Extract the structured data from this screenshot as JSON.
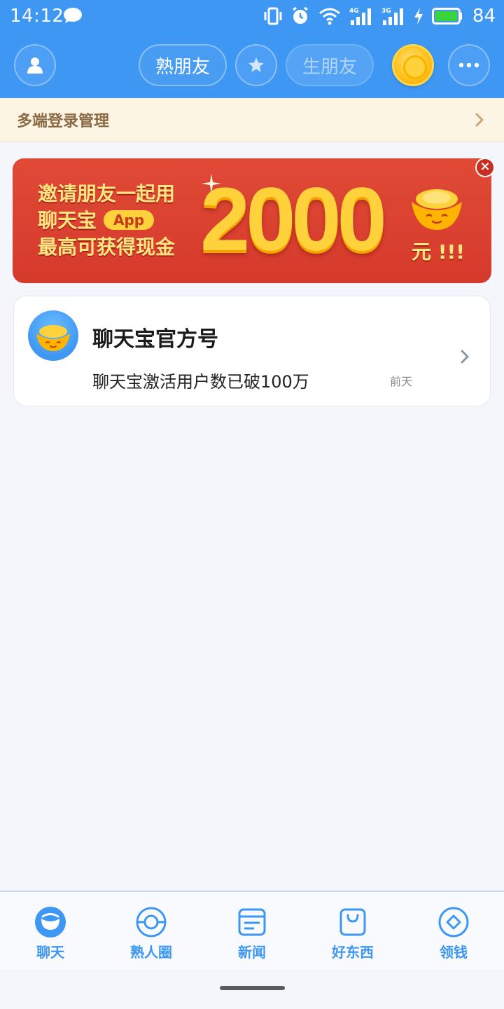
{
  "status_bar": {
    "time": "14:12",
    "battery_percent": "84",
    "signal_4g": "4G",
    "signal_3g": "3G"
  },
  "header": {
    "tab_familiar": "熟朋友",
    "tab_stranger": "生朋友",
    "accent_color": "#3d97f3"
  },
  "login_banner": {
    "label": "多端登录管理"
  },
  "promo": {
    "line1": "邀请朋友一起用",
    "line2": "聊天宝",
    "app_tag": "App",
    "line3": "最高可获得现金",
    "amount": "2000",
    "unit": "元 !!!"
  },
  "chat_list": [
    {
      "name": "聊天宝官方号",
      "preview": "聊天宝激活用户数已破100万",
      "time": "前天"
    }
  ],
  "tabbar": {
    "items": [
      {
        "label": "聊天",
        "icon": "chat-icon"
      },
      {
        "label": "熟人圈",
        "icon": "circle-icon"
      },
      {
        "label": "新闻",
        "icon": "news-icon"
      },
      {
        "label": "好东西",
        "icon": "bag-icon"
      },
      {
        "label": "领钱",
        "icon": "diamond-icon"
      }
    ]
  }
}
